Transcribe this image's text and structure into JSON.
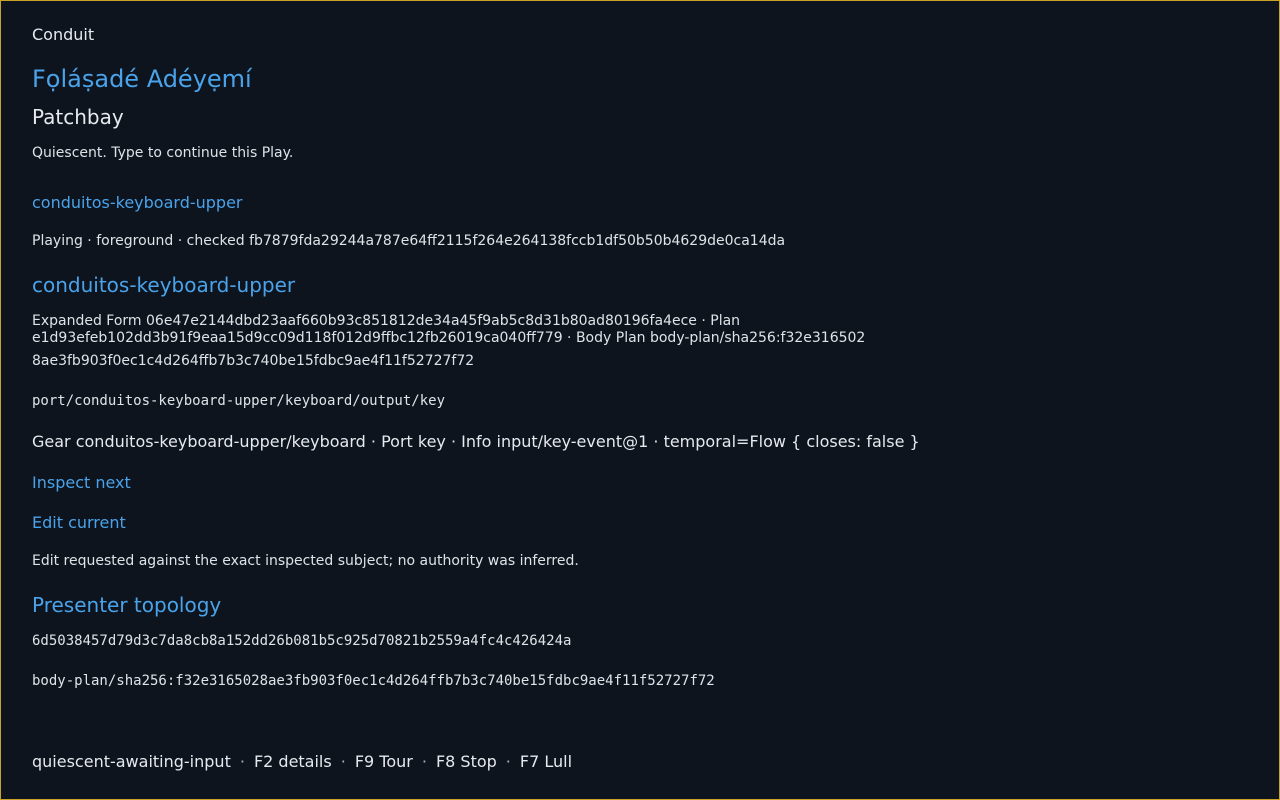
{
  "app": {
    "name": "Conduit"
  },
  "user": {
    "name": "Fọláṣadé Adéyẹmí"
  },
  "section": {
    "title": "Patchbay"
  },
  "status": {
    "text": "Quiescent. Type to continue this Play."
  },
  "gear": {
    "link": "conduitos-keyboard-upper",
    "playing": "Playing · foreground · checked fb7879fda29244a787e64ff2115f264e264138fccb1df50b50b4629de0ca14da",
    "heading": "conduitos-keyboard-upper",
    "expanded_line1": "Expanded Form 06e47e2144dbd23aaf660b93c851812de34a45f9ab5c8d31b80ad80196fa4ece · Plan",
    "expanded_line2": "e1d93efeb102dd3b91f9eaa15d9cc09d118f012d9ffbc12fb26019ca040ff779 · Body Plan body-plan/sha256:f32e316502",
    "expanded_line3": "8ae3fb903f0ec1c4d264ffb7b3c740be15fdbc9ae4f11f52727f72",
    "port_path": "port/conduitos-keyboard-upper/keyboard/output/key",
    "info": "Gear conduitos-keyboard-upper/keyboard · Port key · Info input/key-event@1 · temporal=Flow { closes: false }"
  },
  "actions": {
    "inspect_next": "Inspect next",
    "edit_current": "Edit current",
    "edit_note": "Edit requested against the exact inspected subject; no authority was inferred."
  },
  "presenter": {
    "title": "Presenter topology",
    "hash": "6d5038457d79d3c7da8cb8a152dd26b081b5c925d70821b2559a4fc4c426424a",
    "body_plan": "body-plan/sha256:f32e3165028ae3fb903f0ec1c4d264ffb7b3c740be15fdbc9ae4f11f52727f72"
  },
  "footer": {
    "state": "quiescent-awaiting-input",
    "separator": "·",
    "keys": [
      "F2 details",
      "F9 Tour",
      "F8 Stop",
      "F7 Lull"
    ]
  },
  "colors": {
    "background": "#0d141d",
    "accent": "#4aa3ea",
    "text": "#e6e9ee",
    "border": "#c9a227"
  }
}
